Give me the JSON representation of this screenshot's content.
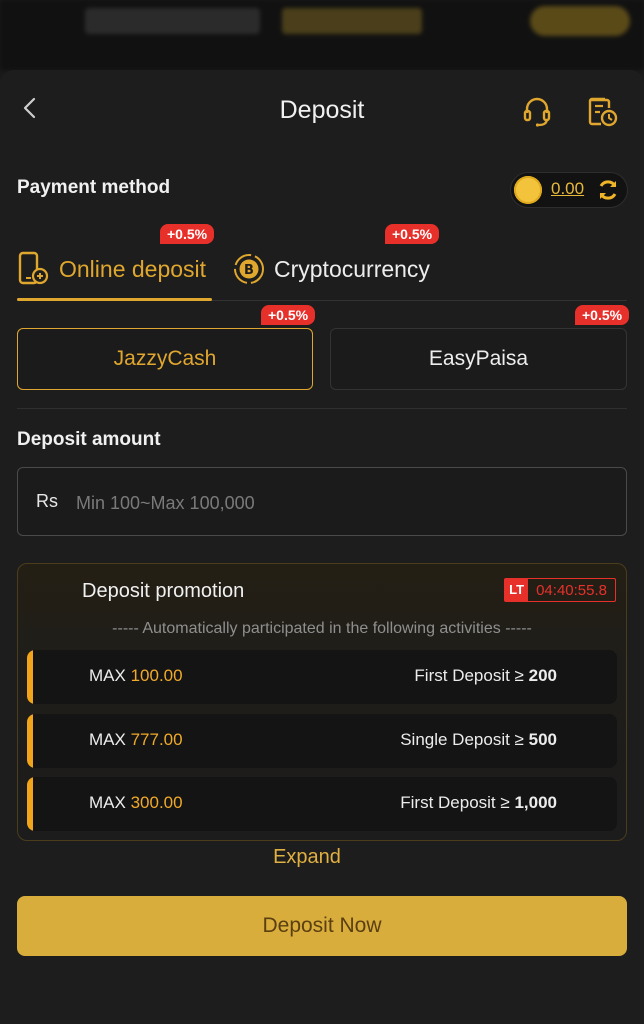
{
  "header": {
    "title": "Deposit"
  },
  "payment": {
    "label": "Payment method",
    "balance": "0.00"
  },
  "tabs": [
    {
      "label": "Online deposit",
      "badge": "+0.5%"
    },
    {
      "label": "Cryptocurrency",
      "badge": "+0.5%"
    }
  ],
  "methods": [
    {
      "label": "JazzyCash",
      "badge": "+0.5%"
    },
    {
      "label": "EasyPaisa",
      "badge": "+0.5%"
    }
  ],
  "amount": {
    "label": "Deposit amount",
    "currency": "Rs",
    "placeholder": "Min 100~Max 100,000"
  },
  "promotion": {
    "title": "Deposit promotion",
    "timer_tag": "LT",
    "timer": "04:40:55.8",
    "subtitle": "----- Automatically participated in the following activities -----",
    "rows": [
      {
        "max_label": "MAX",
        "max_value": "100.00",
        "condition": "First Deposit ≥",
        "threshold": "200"
      },
      {
        "max_label": "MAX",
        "max_value": "777.00",
        "condition": "Single Deposit ≥",
        "threshold": "500"
      },
      {
        "max_label": "MAX",
        "max_value": "300.00",
        "condition": "First Deposit ≥",
        "threshold": "1,000"
      }
    ],
    "expand": "Expand"
  },
  "actions": {
    "deposit_now": "Deposit Now"
  },
  "colors": {
    "accent": "#e0a72e",
    "badge": "#e8302a",
    "button": "#d9ad3c"
  }
}
